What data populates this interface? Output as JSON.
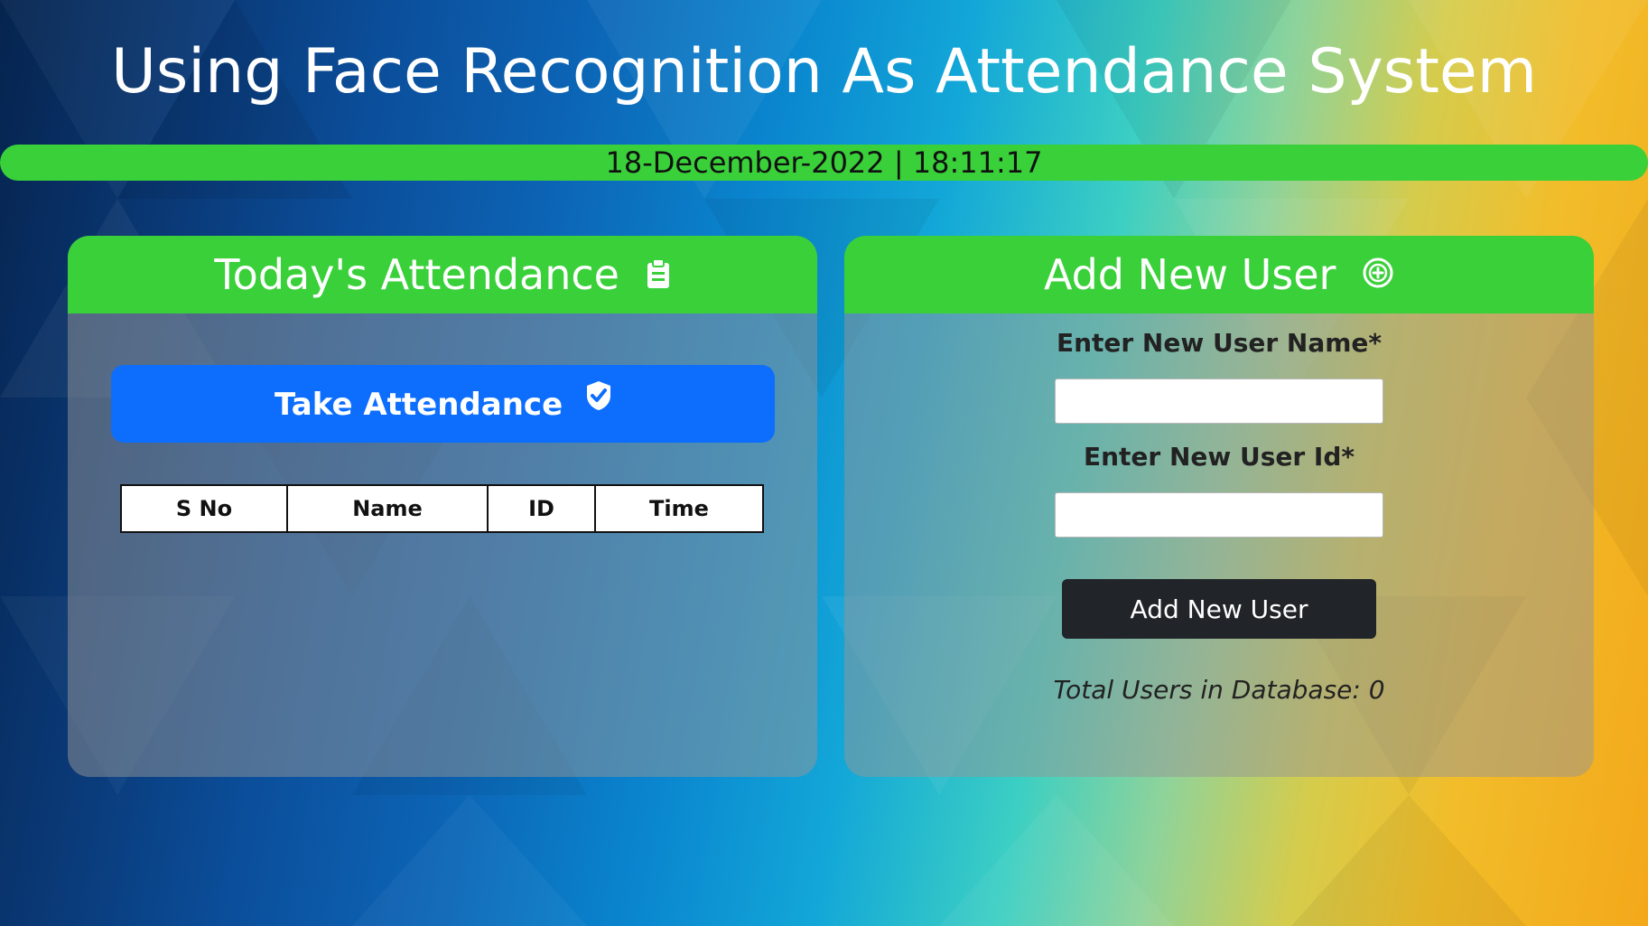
{
  "header": {
    "title": "Using Face Recognition As Attendance System",
    "datetime": "18-December-2022 | 18:11:17"
  },
  "attendance_panel": {
    "title": "Today's Attendance",
    "title_icon": "clipboard-icon",
    "take_button_label": "Take Attendance",
    "take_button_icon": "check-shield-icon",
    "table": {
      "columns": [
        "S No",
        "Name",
        "ID",
        "Time"
      ],
      "rows": []
    }
  },
  "add_user_panel": {
    "title": "Add New User",
    "title_icon": "plus-circle-icon",
    "name_label": "Enter New User Name*",
    "name_value": "",
    "id_label": "Enter New User Id*",
    "id_value": "",
    "submit_label": "Add New User",
    "total_users_text": "Total Users in Database: 0"
  },
  "colors": {
    "accent_green": "#3ad03a",
    "primary_blue": "#0d6efd",
    "dark_button": "#212529"
  }
}
